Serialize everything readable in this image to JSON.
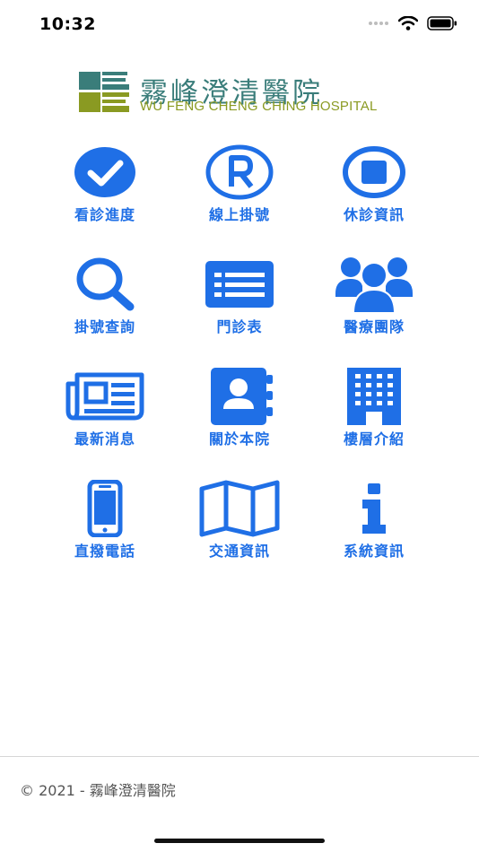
{
  "status_bar": {
    "time": "10:32"
  },
  "logo": {
    "name_cn": "霧峰澄清醫院",
    "name_en": "WU FENG CHENG CHING HOSPITAL"
  },
  "menu": [
    {
      "label": "看診進度",
      "icon": "checkmark-circle-icon"
    },
    {
      "label": "線上掛號",
      "icon": "registered-icon"
    },
    {
      "label": "休診資訊",
      "icon": "stop-circle-icon"
    },
    {
      "label": "掛號查詢",
      "icon": "search-icon"
    },
    {
      "label": "門診表",
      "icon": "list-card-icon"
    },
    {
      "label": "醫療團隊",
      "icon": "users-icon"
    },
    {
      "label": "最新消息",
      "icon": "newspaper-icon"
    },
    {
      "label": "關於本院",
      "icon": "contact-book-icon"
    },
    {
      "label": "樓層介紹",
      "icon": "building-icon"
    },
    {
      "label": "直撥電話",
      "icon": "mobile-phone-icon"
    },
    {
      "label": "交通資訊",
      "icon": "map-icon"
    },
    {
      "label": "系統資訊",
      "icon": "info-icon"
    }
  ],
  "colors": {
    "accent": "#1f6fe6",
    "logo_teal": "#3a7d7a",
    "logo_olive": "#8a9a22"
  },
  "footer": {
    "copyright": "© 2021 - 霧峰澄清醫院"
  }
}
